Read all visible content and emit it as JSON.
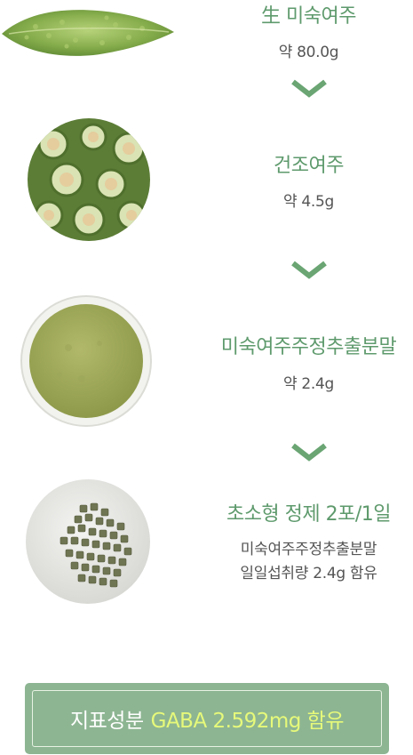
{
  "steps": [
    {
      "title": "生 미숙여주",
      "amount": "약 80.0g",
      "image": "raw-bitter-melon"
    },
    {
      "title": "건조여주",
      "amount": "약 4.5g",
      "image": "dried-bitter-melon-slices"
    },
    {
      "title": "미숙여주주정추출분말",
      "amount": "약 2.4g",
      "image": "extract-powder-bowl"
    },
    {
      "title": "초소형 정제 2포/1일",
      "line1": "미숙여주주정추출분말",
      "line2": "일일섭취량 2.4g 함유",
      "image": "small-tablets-plate"
    }
  ],
  "footer": {
    "label": "지표성분",
    "highlight": "GABA 2.592mg 함유"
  },
  "colors": {
    "accent_green": "#5e9a6c",
    "arrow_green": "#6aa573",
    "footer_bg": "#8db592",
    "footer_highlight": "#e6f97a"
  },
  "icons": [
    "chevron-down-icon"
  ]
}
